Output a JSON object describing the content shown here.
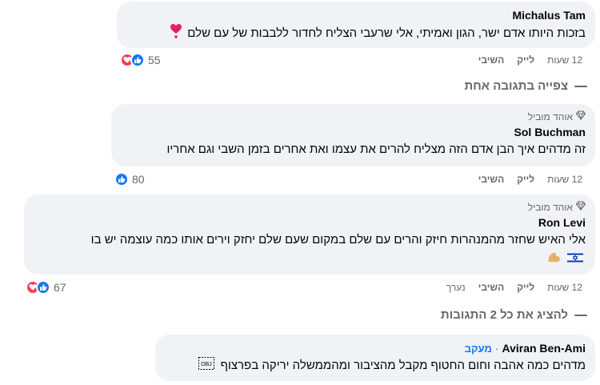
{
  "comments": [
    {
      "author": "Michalus Tam",
      "text": "בזכות היותו אדם ישר, הגון ואמיתי, אלי שרעבי הצליח לחדור ללבבות של עם שלם",
      "emoji": "heart-exclamation",
      "time": "12 שעות",
      "like_label": "לייק",
      "reply_label": "השיבי",
      "reaction_count": "55"
    },
    {
      "badge": "אוהד מוביל",
      "author": "Sol Buchman",
      "text": "זה מדהים איך הבן אדם הזה מצליח להרים את עצמו ואת אחרים בזמן השבי וגם אחריו",
      "time": "12 שעות",
      "like_label": "לייק",
      "reply_label": "השיבי",
      "reaction_count": "80"
    },
    {
      "badge": "אוהד מוביל",
      "author": "Ron Levi",
      "text": "אלי האיש שחזר מהמנהרות חיזק והרים עם שלם במקום שעם שלם יחזק וירים אותו כמה עוצמה יש בו",
      "emojis": [
        "israel-flag",
        "flexed-biceps"
      ],
      "time": "12 שעות",
      "like_label": "לייק",
      "reply_label": "השיבי",
      "edited_label": "נערך",
      "reaction_count": "67"
    },
    {
      "author": "Aviran Ben-Ami",
      "follow_label": "מעקב",
      "separator": "·",
      "text": "מדהים כמה אהבה וחום החטוף מקבל מהציבור ומהממשלה יריקה בפרצוף",
      "emoji": "obj-replacement"
    }
  ],
  "thread_links": {
    "view_one_reply": "צפייה בתגובה אחת",
    "view_all_replies": "להציג את כל 2 התגובות"
  },
  "colors": {
    "bubble": "#f0f2f5",
    "secondary_text": "#65676b",
    "like_blue": "#1877f2",
    "love_red": "#f33e58"
  }
}
